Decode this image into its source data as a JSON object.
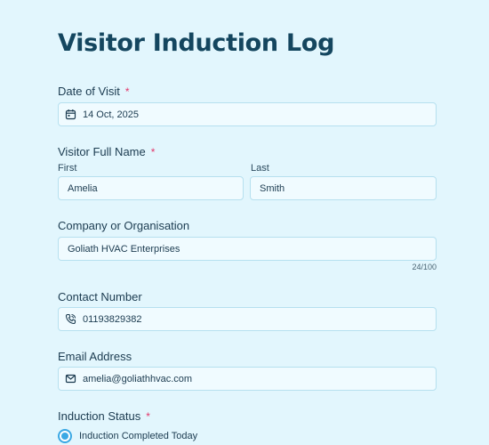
{
  "form": {
    "title": "Visitor Induction Log",
    "date": {
      "label": "Date of Visit",
      "required": "*",
      "value": "14 Oct, 2025",
      "icon": "calendar-icon"
    },
    "name": {
      "label": "Visitor Full Name",
      "required": "*",
      "first_label": "First",
      "first_value": "Amelia",
      "last_label": "Last",
      "last_value": "Smith"
    },
    "company": {
      "label": "Company or Organisation",
      "value": "Goliath HVAC Enterprises",
      "counter": "24/100"
    },
    "contact": {
      "label": "Contact Number",
      "value": "01193829382",
      "icon": "phone-icon"
    },
    "email": {
      "label": "Email Address",
      "value": "amelia@goliathhvac.com",
      "icon": "mail-icon"
    },
    "induction": {
      "label": "Induction Status",
      "required": "*",
      "option_1": "Induction Completed Today"
    }
  },
  "colors": {
    "background": "#e2f6fd",
    "title": "#14465f",
    "required": "#e3366a",
    "accent": "#3aa8e4"
  }
}
